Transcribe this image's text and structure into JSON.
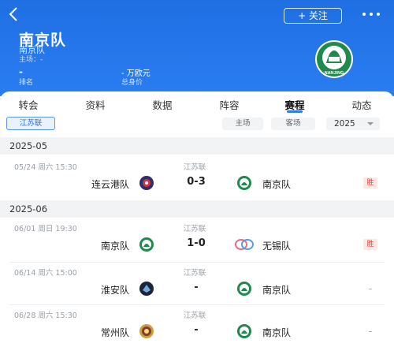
{
  "header": {
    "back_icon": "chevron-left-icon",
    "follow_label": "+ 关注",
    "more_icon": "more-dots-icon",
    "team_name": "南京队",
    "team_sub": "南京队",
    "home_ground": "主场：-",
    "rank_value": "-",
    "rank_label": "排名",
    "value_amount": "-  万欧元",
    "value_label": "总身价",
    "logo_text": "NANJING",
    "brand_color": "#2a7df0"
  },
  "tabs": [
    {
      "label": "转会"
    },
    {
      "label": "资料"
    },
    {
      "label": "数据"
    },
    {
      "label": "阵容"
    },
    {
      "label": "赛程"
    },
    {
      "label": "动态"
    }
  ],
  "active_tab": "赛程",
  "filters": {
    "league": "江苏联",
    "home": "主场",
    "away": "客场",
    "year": "2025"
  },
  "sections": [
    {
      "month": "2025-05"
    },
    {
      "month": "2025-06"
    }
  ],
  "matches": [
    {
      "date": "05/24  周六 15:30",
      "league": "江苏联",
      "home": "连云港队",
      "score": "0-3",
      "away": "南京队",
      "result": "胜"
    },
    {
      "date": "06/01  周日 19:30",
      "league": "江苏联",
      "home": "南京队",
      "score": "1-0",
      "away": "无锡队",
      "result": "胜"
    },
    {
      "date": "06/14  周六 15:00",
      "league": "江苏联",
      "home": "淮安队",
      "score": "-",
      "away": "南京队",
      "result": "-"
    },
    {
      "date": "06/28  周六 15:30",
      "league": "江苏联",
      "home": "常州队",
      "score": "-",
      "away": "南京队",
      "result": "-"
    }
  ]
}
